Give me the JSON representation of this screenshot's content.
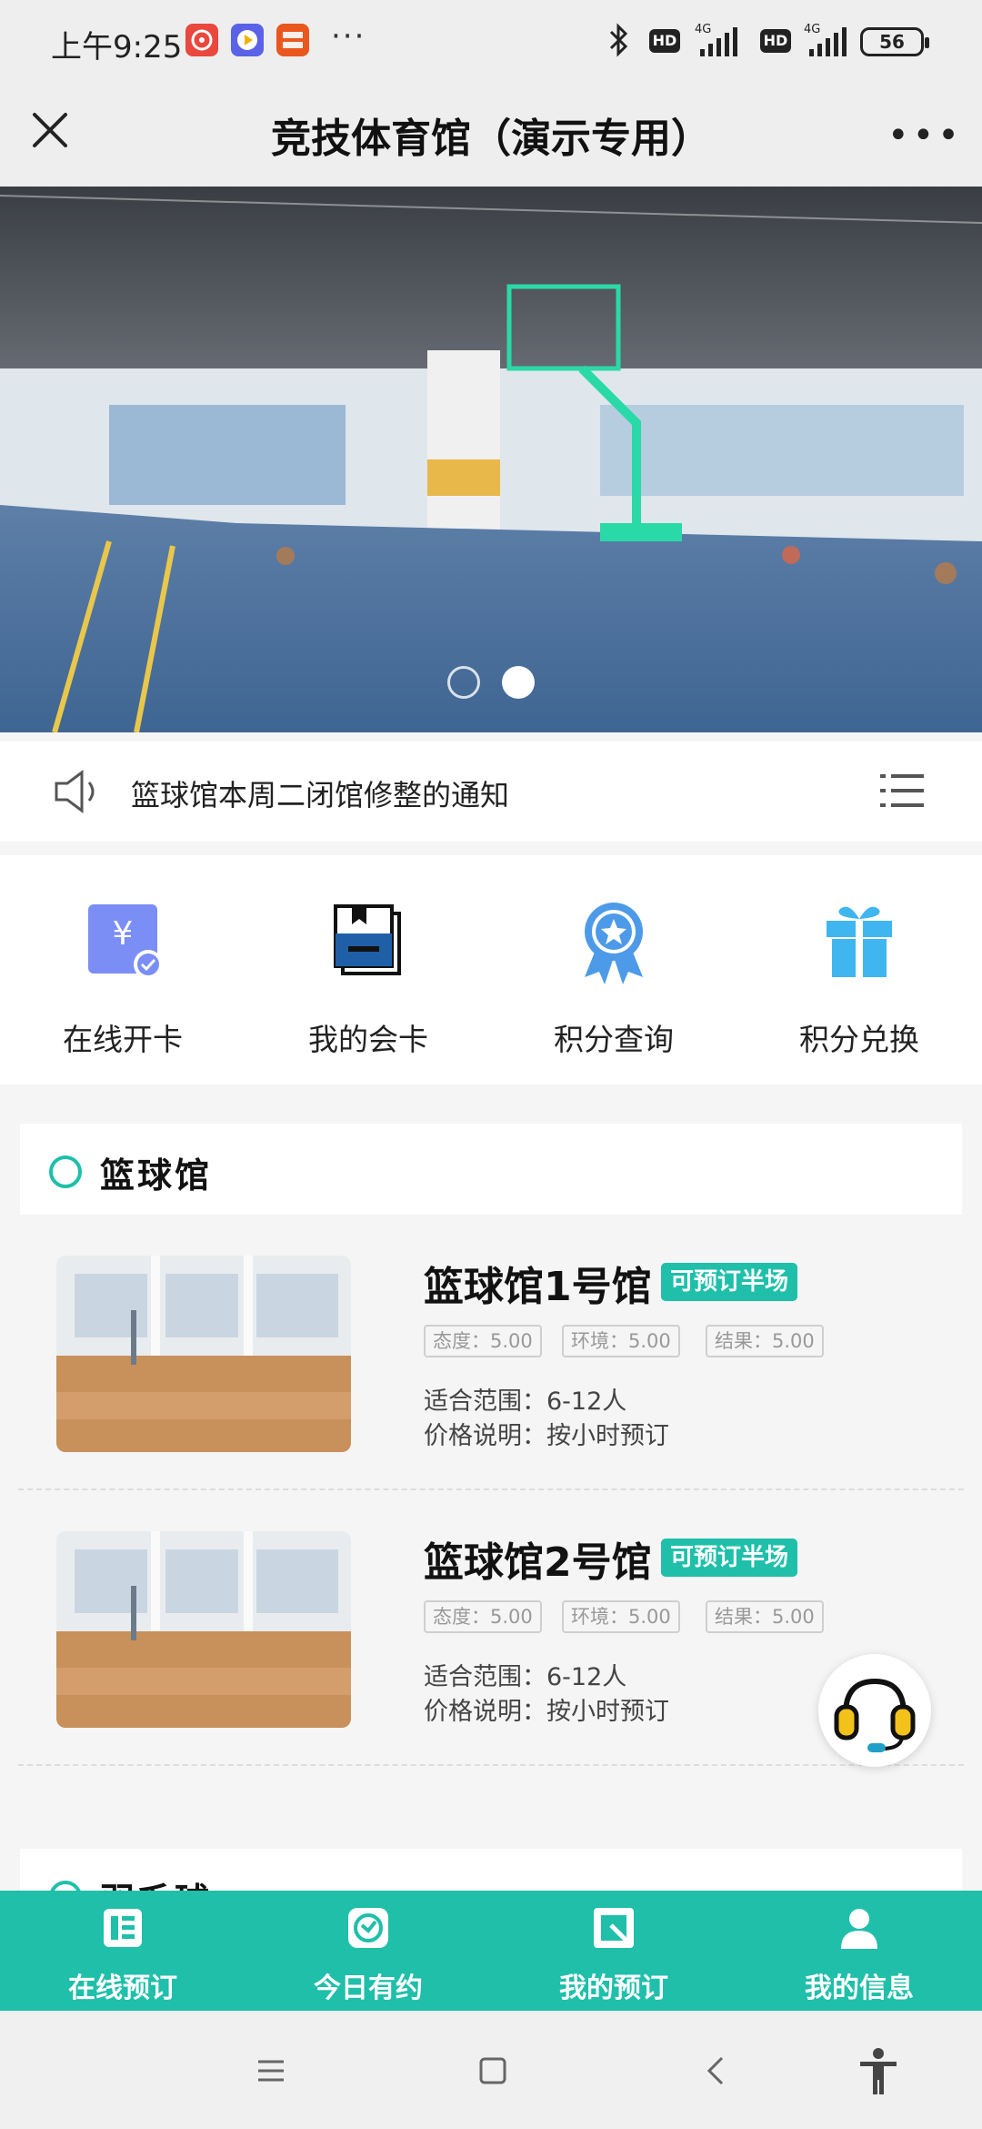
{
  "status_bar": {
    "time": "上午9:25",
    "more": "···",
    "hd": "HD",
    "network": "4G",
    "battery": "56"
  },
  "nav": {
    "title": "竞技体育馆（演示专用）",
    "more": "•••"
  },
  "banner": {
    "slides": 2,
    "active_slide": 2
  },
  "notice": {
    "text": "篮球馆本周二闭馆修整的通知"
  },
  "quick_menu": [
    {
      "label": "在线开卡",
      "icon": "card-yen-icon"
    },
    {
      "label": "我的会卡",
      "icon": "member-card-icon"
    },
    {
      "label": "积分查询",
      "icon": "points-badge-icon"
    },
    {
      "label": "积分兑换",
      "icon": "gift-icon"
    }
  ],
  "sections": [
    {
      "title": "篮球馆",
      "venues": [
        {
          "name": "篮球馆1号馆",
          "badge": "可预订半场",
          "ratings": [
            "态度：5.00",
            "环境：5.00",
            "结果：5.00"
          ],
          "capacity": "适合范围：6-12人",
          "price": "价格说明：按小时预订"
        },
        {
          "name": "篮球馆2号馆",
          "badge": "可预订半场",
          "ratings": [
            "态度：5.00",
            "环境：5.00",
            "结果：5.00"
          ],
          "capacity": "适合范围：6-12人",
          "price": "价格说明：按小时预订"
        }
      ]
    },
    {
      "title": "羽毛球"
    }
  ],
  "tab_bar": [
    {
      "label": "在线预订",
      "icon": "booking-list-icon"
    },
    {
      "label": "今日有约",
      "icon": "clock-icon"
    },
    {
      "label": "我的预订",
      "icon": "my-booking-icon"
    },
    {
      "label": "我的信息",
      "icon": "user-icon"
    }
  ],
  "colors": {
    "accent": "#1fbfaa",
    "card_blue": "#7b8ef5",
    "badge_blue": "#4d9be8",
    "gift_blue": "#3fb6ef"
  }
}
